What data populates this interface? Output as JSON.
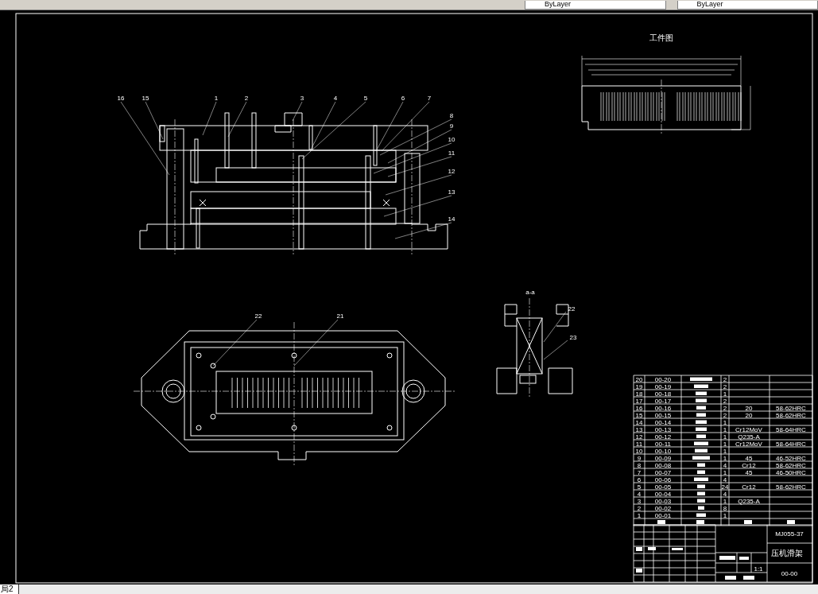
{
  "toolbar": {
    "dropdowns": [
      {
        "value": "ByLayer"
      },
      {
        "value": "ByLayer"
      }
    ]
  },
  "drawing": {
    "front_view": {
      "balloons": [
        "16",
        "15",
        "1",
        "2",
        "3",
        "4",
        "5",
        "6",
        "7",
        "8",
        "9",
        "10",
        "11",
        "12",
        "13",
        "14"
      ]
    },
    "plan_view": {
      "balloons": [
        "22",
        "21"
      ]
    },
    "section_view": {
      "title": "a-a",
      "balloons": [
        "22",
        "23"
      ]
    },
    "workpiece": {
      "title": "工件图"
    }
  },
  "parts_list": {
    "rows": [
      {
        "no": "20",
        "code": "00-20",
        "qty": "2",
        "material": "",
        "hardness": ""
      },
      {
        "no": "19",
        "code": "00-19",
        "qty": "2",
        "material": "",
        "hardness": ""
      },
      {
        "no": "18",
        "code": "00-18",
        "qty": "1",
        "material": "",
        "hardness": ""
      },
      {
        "no": "17",
        "code": "00-17",
        "qty": "2",
        "material": "",
        "hardness": ""
      },
      {
        "no": "16",
        "code": "00-16",
        "qty": "2",
        "material": "20",
        "hardness": "58-62HRC"
      },
      {
        "no": "15",
        "code": "00-15",
        "qty": "2",
        "material": "20",
        "hardness": "58-62HRC"
      },
      {
        "no": "14",
        "code": "00-14",
        "qty": "1",
        "material": "",
        "hardness": ""
      },
      {
        "no": "13",
        "code": "00-13",
        "qty": "1",
        "material": "Cr12MoV",
        "hardness": "58-64HRC"
      },
      {
        "no": "12",
        "code": "00-12",
        "qty": "1",
        "material": "Q235-A",
        "hardness": ""
      },
      {
        "no": "11",
        "code": "00-11",
        "qty": "1",
        "material": "Cr12MoV",
        "hardness": "58-64HRC"
      },
      {
        "no": "10",
        "code": "00-10",
        "qty": "1",
        "material": "",
        "hardness": ""
      },
      {
        "no": "9",
        "code": "00-09",
        "qty": "1",
        "material": "45",
        "hardness": "46-52HRC"
      },
      {
        "no": "8",
        "code": "00-08",
        "qty": "4",
        "material": "Cr12",
        "hardness": "58-62HRC"
      },
      {
        "no": "7",
        "code": "00-07",
        "qty": "1",
        "material": "45",
        "hardness": "46-50HRC"
      },
      {
        "no": "6",
        "code": "00-06",
        "qty": "4",
        "material": "",
        "hardness": ""
      },
      {
        "no": "5",
        "code": "00-05",
        "qty": "24",
        "material": "Cr12",
        "hardness": "58-62HRC"
      },
      {
        "no": "4",
        "code": "00-04",
        "qty": "4",
        "material": "",
        "hardness": ""
      },
      {
        "no": "3",
        "code": "00-03",
        "qty": "1",
        "material": "Q235-A",
        "hardness": ""
      },
      {
        "no": "2",
        "code": "00-02",
        "qty": "8",
        "material": "",
        "hardness": ""
      },
      {
        "no": "1",
        "code": "00-01",
        "qty": "1",
        "material": "",
        "hardness": ""
      }
    ]
  },
  "title_block": {
    "drawing_no": "MJ055-37",
    "title": "压机滑架",
    "scale": "1:1",
    "code": "00-00"
  },
  "layout_tabs": [
    {
      "label": "局2",
      "selected": true
    }
  ]
}
